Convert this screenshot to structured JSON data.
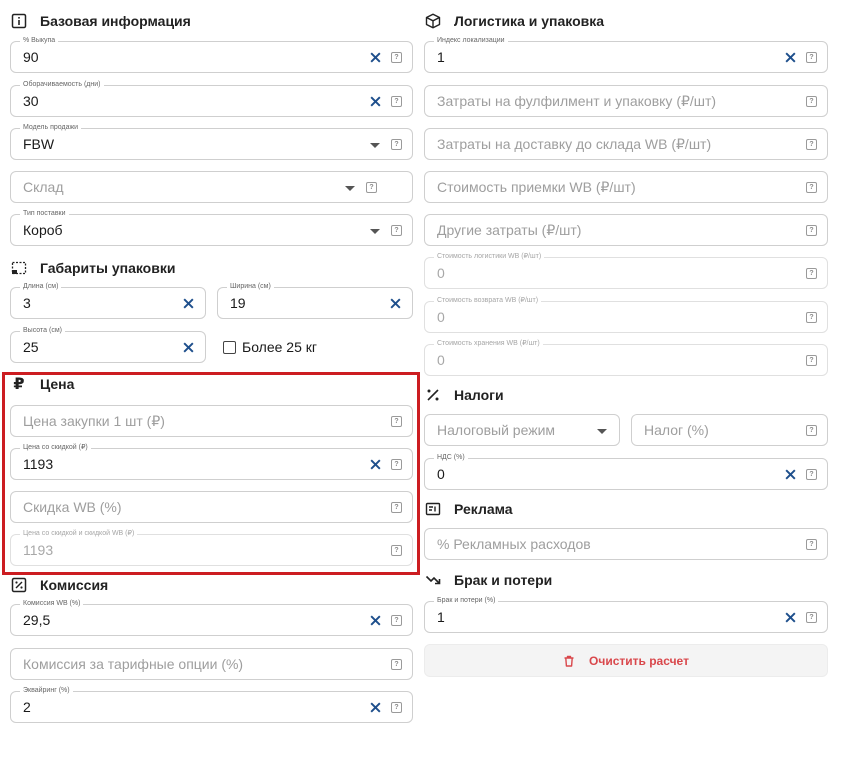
{
  "basic": {
    "title": "Базовая информация",
    "buyout_label": "% Выкупа",
    "buyout_value": "90",
    "turnover_label": "Оборачиваемость (дни)",
    "turnover_value": "30",
    "model_label": "Модель продажи",
    "model_value": "FBW",
    "warehouse_placeholder": "Склад",
    "supply_label": "Тип поставки",
    "supply_value": "Короб"
  },
  "dims": {
    "title": "Габариты упаковки",
    "length_label": "Длина (см)",
    "length_value": "3",
    "width_label": "Ширина (см)",
    "width_value": "19",
    "height_label": "Высота (см)",
    "height_value": "25",
    "heavy_label": "Более 25 кг"
  },
  "price": {
    "title": "Цена",
    "purchase_placeholder": "Цена закупки 1 шт (₽)",
    "discount_price_label": "Цена со скидкой (₽)",
    "discount_price_value": "1193",
    "wb_discount_placeholder": "Скидка WB (%)",
    "final_price_label": "Цена со скидкой и скидкой WB (₽)",
    "final_price_value": "1193"
  },
  "commission": {
    "title": "Комиссия",
    "wb_label": "Комиссия WB (%)",
    "wb_value": "29,5",
    "tariff_placeholder": "Комиссия за тарифные опции (%)",
    "acquiring_label": "Эквайринг (%)",
    "acquiring_value": "2"
  },
  "logistics": {
    "title": "Логистика и упаковка",
    "loc_label": "Индекс локализации",
    "loc_value": "1",
    "fulfillment_placeholder": "Затраты на фулфилмент и упаковку (₽/шт)",
    "delivery_placeholder": "Затраты на доставку до склада WB (₽/шт)",
    "acceptance_placeholder": "Стоимость приемки WB (₽/шт)",
    "other_placeholder": "Другие затраты (₽/шт)",
    "logistics_cost_label": "Стоимость логистики WB (₽/шт)",
    "logistics_cost_value": "0",
    "return_cost_label": "Стоимость возврата WB (₽/шт)",
    "return_cost_value": "0",
    "storage_cost_label": "Стоимость хранения WB (₽/шт)",
    "storage_cost_value": "0"
  },
  "taxes": {
    "title": "Налоги",
    "regime_placeholder": "Налоговый режим",
    "tax_placeholder": "Налог (%)",
    "vat_label": "НДС (%)",
    "vat_value": "0"
  },
  "ads": {
    "title": "Реклама",
    "ads_placeholder": "% Рекламных расходов"
  },
  "defects": {
    "title": "Брак и потери",
    "defects_label": "Брак и потери (%)",
    "defects_value": "1"
  },
  "actions": {
    "clear_label": "Очистить расчет"
  },
  "help_glyph": "?",
  "colors": {
    "accent": "#1e4f8c",
    "danger": "#d9474b",
    "highlight": "#cc1d21"
  }
}
